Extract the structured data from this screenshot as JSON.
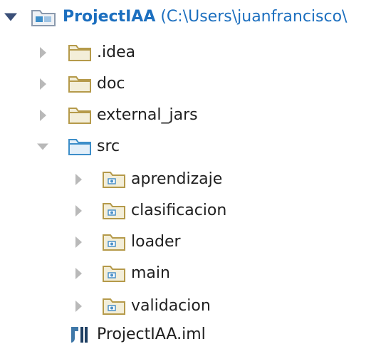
{
  "tree": {
    "root": {
      "name": "ProjectIAA",
      "path": " (C:\\Users\\juanfrancisco\\",
      "icon": "project-module-icon",
      "expanded": true
    },
    "items": [
      {
        "label": ".idea",
        "icon": "folder-icon"
      },
      {
        "label": "doc",
        "icon": "folder-icon"
      },
      {
        "label": "external_jars",
        "icon": "folder-icon"
      },
      {
        "label": "src",
        "icon": "source-folder-icon",
        "expanded": true
      },
      {
        "label": "aprendizaje",
        "icon": "package-folder-icon"
      },
      {
        "label": "clasificacion",
        "icon": "package-folder-icon"
      },
      {
        "label": "loader",
        "icon": "package-folder-icon"
      },
      {
        "label": "main",
        "icon": "package-folder-icon"
      },
      {
        "label": "validacion",
        "icon": "package-folder-icon"
      },
      {
        "label": "ProjectIAA.iml",
        "icon": "iml-file-icon"
      }
    ]
  },
  "colors": {
    "root_text": "#1c6fbf",
    "folder_outline": "#b59a4a",
    "source_folder": "#3d8ec9",
    "package_dot": "#4a90c8",
    "expander_gray": "#b9b9b9",
    "expander_dark": "#3a4f78"
  }
}
